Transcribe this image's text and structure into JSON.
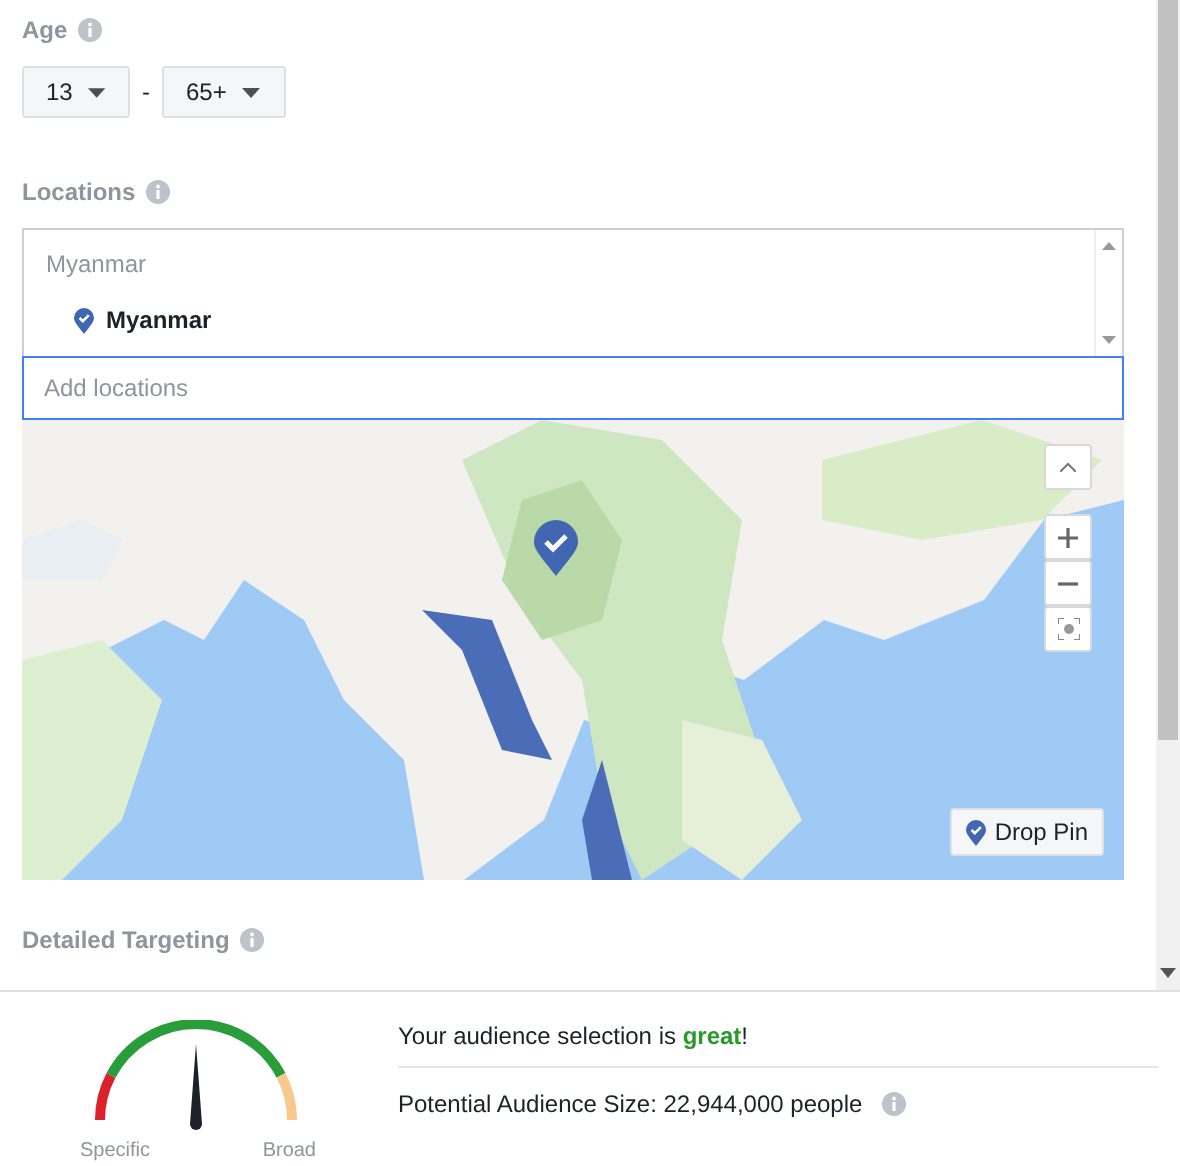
{
  "age": {
    "label": "Age",
    "min": "13",
    "separator": "-",
    "max": "65+"
  },
  "locations": {
    "label": "Locations",
    "group": "Myanmar",
    "items": [
      {
        "name": "Myanmar"
      }
    ],
    "search": {
      "placeholder": "Add locations"
    }
  },
  "map": {
    "kind": "picture",
    "drop_pin": "Drop Pin"
  },
  "detailed_targeting": {
    "label": "Detailed Targeting"
  },
  "audience": {
    "message": "Your audience selection is **great**!",
    "size": "Potential Audience Size: 22,944,000 people",
    "gauge": {
      "level": 0.5,
      "low": "Specific",
      "high": "Broad"
    }
  }
}
